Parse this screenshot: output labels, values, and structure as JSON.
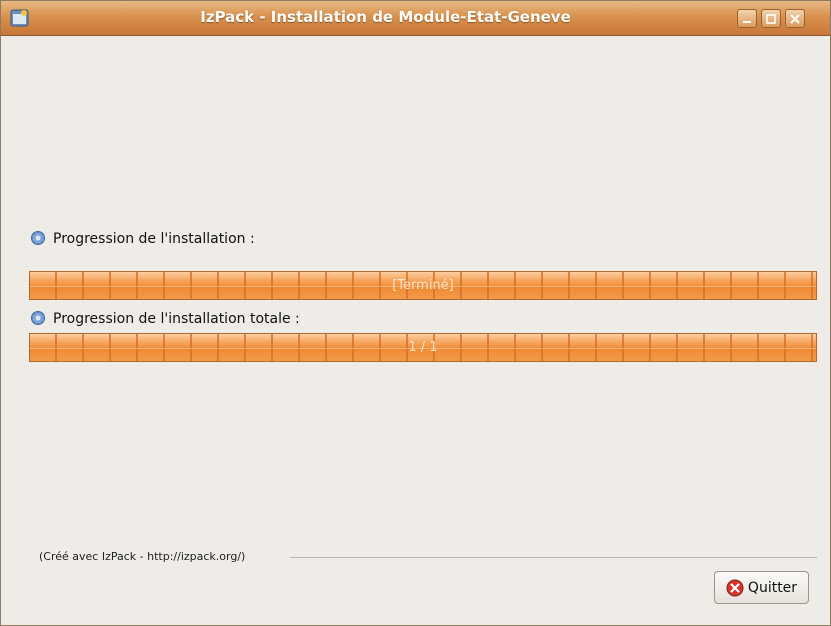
{
  "window": {
    "title": "IzPack - Installation de Module-Etat-Geneve",
    "controls": [
      "minimize-icon",
      "maximize-icon",
      "close-icon"
    ]
  },
  "progress": {
    "pack_label": "Progression de l'installation :",
    "pack_text": "[Terminé]",
    "pack_fraction": 1.0,
    "overall_label": "Progression de l'installation totale :",
    "overall_text": "1 / 1",
    "overall_fraction": 1.0
  },
  "footer": {
    "credit": "(Créé avec IzPack - http://izpack.org/)"
  },
  "buttons": {
    "quit_label": "Quitter",
    "quit_icon": "error-icon"
  },
  "colors": {
    "titlebar": "#d8914d",
    "progress": "#f08a33",
    "background": "#efebe7"
  }
}
